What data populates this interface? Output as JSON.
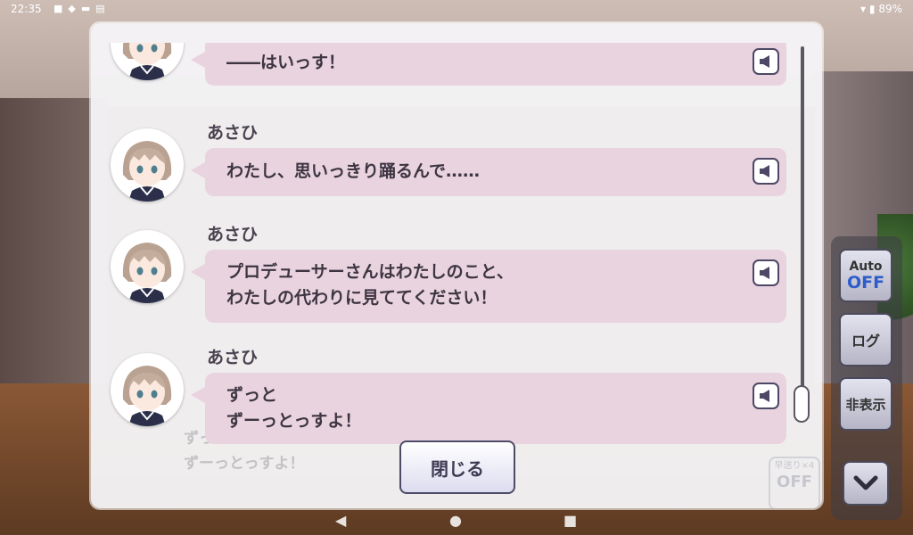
{
  "status_bar": {
    "time": "22:35",
    "battery": "89%"
  },
  "log": {
    "entries": [
      {
        "speaker": "",
        "text": "――はいっす！"
      },
      {
        "speaker": "あさひ",
        "text": "わたし、思いっきり踊るんで……"
      },
      {
        "speaker": "あさひ",
        "text": "プロデューサーさんはわたしのこと、\nわたしの代わりに見ててください！"
      },
      {
        "speaker": "あさひ",
        "text": "ずっと\nずーっとっすよ！"
      }
    ],
    "voice_icon": "speaker-icon",
    "close_label": "閉じる"
  },
  "background_dialog": {
    "text": "ずっと\nずーっとっすよ！",
    "badge_line1": "早送り×4",
    "badge_line2": "OFF"
  },
  "side_controls": {
    "auto_label": "Auto",
    "auto_state": "OFF",
    "log_label": "ログ",
    "hide_label": "非表示",
    "down_icon": "chevron-down-icon"
  },
  "colors": {
    "bubble": "#e9d3de",
    "accent_blue": "#2e5cc8",
    "border": "#4d4866"
  }
}
